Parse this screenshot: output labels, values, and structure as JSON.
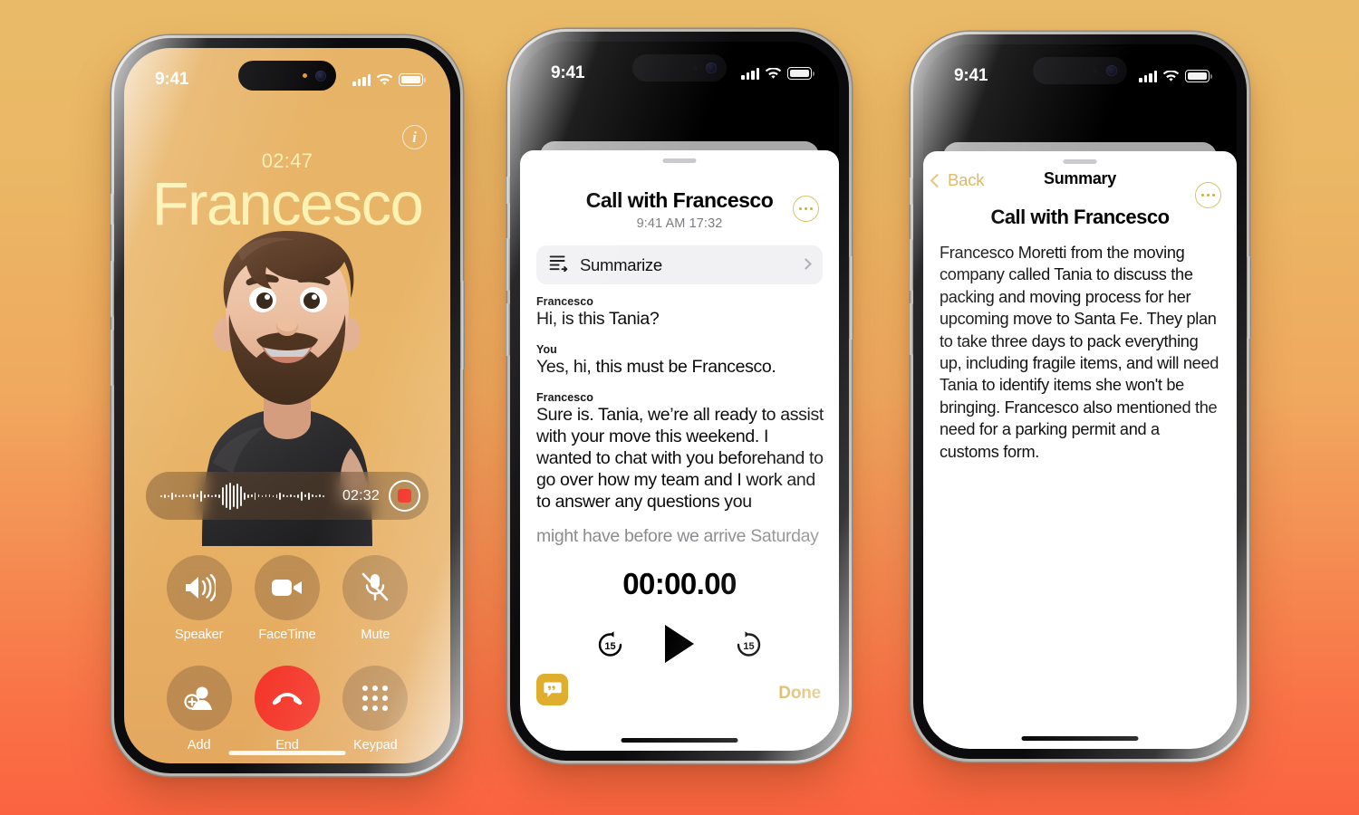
{
  "background": {
    "gradient_top": "#e9bb68",
    "gradient_bottom": "#fb6340"
  },
  "accent": {
    "gold": "#d8b253",
    "amber_button": "#dfae2c",
    "end_call_red": "#f4372a",
    "record_red": "#f02b1d",
    "call_bg": "#e7b367",
    "name_text": "#fdf1b3"
  },
  "phone1": {
    "name": "in-call-screen",
    "status_bar": {
      "time": "9:41",
      "signal": "cellular-bars-4",
      "wifi": "wifi-icon",
      "battery": "battery-full-icon"
    },
    "info_button": "i",
    "call_duration": "02:47",
    "callee_name": "Francesco",
    "avatar": "memoji-avatar",
    "recorder": {
      "waveform": "audio-waveform",
      "elapsed": "02:32",
      "stop_button": "stop-recording-icon"
    },
    "controls": [
      {
        "icon": "speaker-icon",
        "label": "Speaker",
        "style": "glass"
      },
      {
        "icon": "video-camera-icon",
        "label": "FaceTime",
        "style": "glass"
      },
      {
        "icon": "microphone-muted-icon",
        "label": "Mute",
        "style": "glass"
      },
      {
        "icon": "add-contact-icon",
        "label": "Add",
        "style": "glass"
      },
      {
        "icon": "end-call-icon",
        "label": "End",
        "style": "red"
      },
      {
        "icon": "keypad-icon",
        "label": "Keypad",
        "style": "glass"
      }
    ]
  },
  "phone2": {
    "name": "call-recording-transcript-sheet",
    "status_bar": {
      "time": "9:41",
      "signal": "cellular-bars-4",
      "wifi": "wifi-icon",
      "battery": "battery-full-icon"
    },
    "title": "Call with Francesco",
    "subtitle": "9:41 AM  17:32",
    "more_button": "more-options-icon",
    "summarize": {
      "icon": "summarize-lines-icon",
      "label": "Summarize",
      "chevron": "chevron-right-icon"
    },
    "transcript": [
      {
        "speaker": "Francesco",
        "text": "Hi, is this Tania?",
        "faded": false
      },
      {
        "speaker": "You",
        "text": "Yes, hi, this must be Francesco.",
        "faded": false
      },
      {
        "speaker": "Francesco",
        "text": "Sure is. Tania, we’re all ready to assist with your move this weekend. I wanted to chat with you beforehand to go over how my team and I work and to answer any questions you",
        "faded": false
      },
      {
        "speaker": "",
        "text": "might have before we arrive Saturday",
        "faded": true
      }
    ],
    "player": {
      "time": "00:00.00",
      "skip_back": "skip-back-15-icon",
      "play": "play-icon",
      "skip_forward": "skip-forward-15-icon"
    },
    "quote_button": "transcript-quote-icon",
    "done_label": "Done"
  },
  "phone3": {
    "name": "call-summary-sheet",
    "status_bar": {
      "time": "9:41",
      "signal": "cellular-bars-4",
      "wifi": "wifi-icon",
      "battery": "battery-full-icon"
    },
    "back_label": "Back",
    "nav_title": "Summary",
    "more_button": "more-options-icon",
    "heading": "Call with Francesco",
    "body": "Francesco Moretti from the moving company called Tania to discuss the packing and moving process for her upcoming move to Santa Fe. They plan to take three days to pack everything up, including fragile items, and will need Tania to identify items she won't be bringing. Francesco also mentioned the need for a parking permit and a customs form."
  }
}
